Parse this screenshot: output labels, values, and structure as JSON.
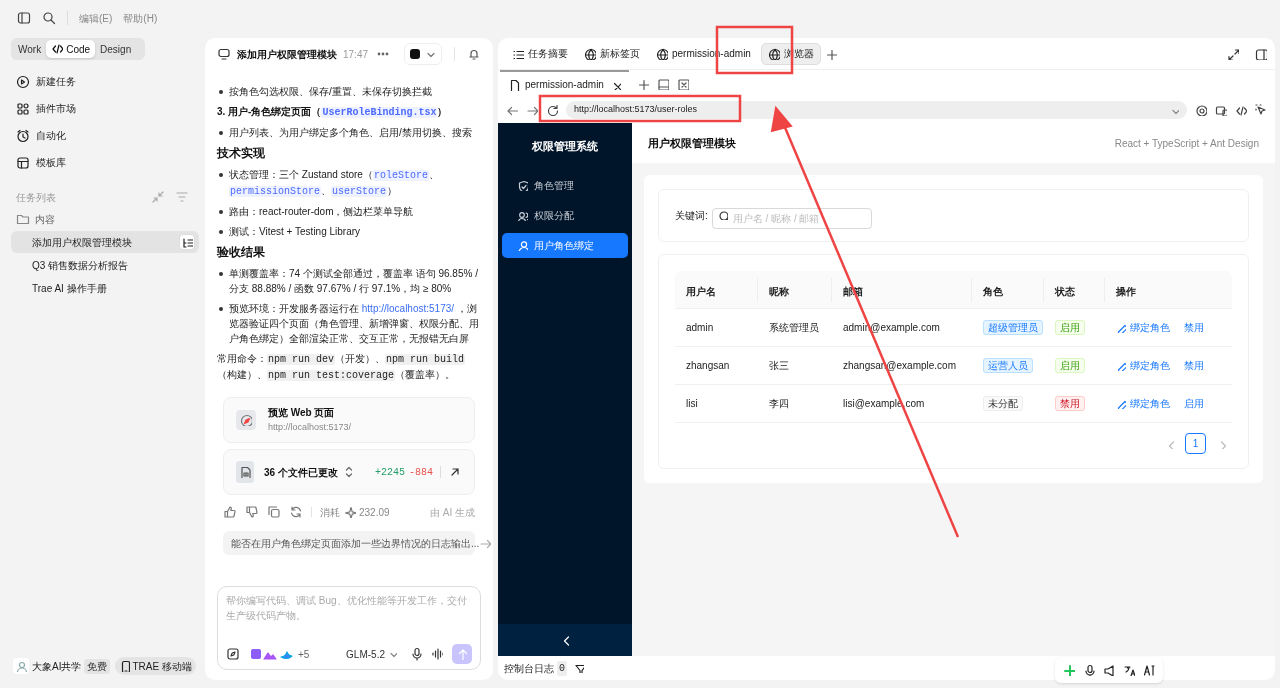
{
  "menu": [
    "编辑(E)",
    "帮助(H)"
  ],
  "modes": [
    {
      "label": "Work",
      "selected": false
    },
    {
      "label": "Code",
      "selected": true
    },
    {
      "label": "Design",
      "selected": false
    }
  ],
  "nav": [
    {
      "label": "新建任务",
      "kind": "new"
    },
    {
      "label": "插件市场",
      "kind": "plugins"
    },
    {
      "label": "自动化",
      "kind": "clock"
    },
    {
      "label": "模板库",
      "kind": "template"
    }
  ],
  "task_list": {
    "title": "任务列表",
    "folder": "内容",
    "tasks": [
      {
        "label": "添加用户权限管理模块",
        "selected": true
      },
      {
        "label": "Q3 销售数据分析报告",
        "selected": false
      },
      {
        "label": "Trae AI 操作手册",
        "selected": false
      }
    ]
  },
  "user": {
    "name": "大象AI共学",
    "badge": "免费"
  },
  "mobile_button": "TRAE 移动端",
  "chat": {
    "title": "添加用户权限管理模块",
    "time": "17:47",
    "blocks": [
      {
        "kind": "bullet",
        "parts": [
          {
            "kind": "text",
            "text": "按角色勾选权限、保存/重置、未保存切换拦截"
          }
        ]
      },
      {
        "kind": "subhead",
        "parts": [
          {
            "kind": "text",
            "text": "3. 用户-角色绑定页面（"
          },
          {
            "kind": "code",
            "text": "UserRoleBinding.tsx"
          },
          {
            "kind": "text",
            "text": "）"
          }
        ]
      },
      {
        "kind": "bullet",
        "parts": [
          {
            "kind": "text",
            "text": "用户列表、为用户绑定多个角色、启用/禁用切换、搜索"
          }
        ]
      },
      {
        "kind": "heading",
        "parts": [
          {
            "kind": "text",
            "text": "技术实现"
          }
        ]
      },
      {
        "kind": "bullet",
        "parts": [
          {
            "kind": "text",
            "text": "状态管理：三个 Zustand store（"
          },
          {
            "kind": "code",
            "text": "roleStore"
          },
          {
            "kind": "text",
            "text": "、"
          },
          {
            "kind": "code",
            "text": "permissionStore"
          },
          {
            "kind": "text",
            "text": "、"
          },
          {
            "kind": "code",
            "text": "userStore"
          },
          {
            "kind": "text",
            "text": "）"
          }
        ]
      },
      {
        "kind": "bullet",
        "parts": [
          {
            "kind": "text",
            "text": "路由：react-router-dom，侧边栏菜单导航"
          }
        ]
      },
      {
        "kind": "bullet",
        "parts": [
          {
            "kind": "text",
            "text": "测试：Vitest + Testing Library"
          }
        ]
      },
      {
        "kind": "heading",
        "parts": [
          {
            "kind": "text",
            "text": "验收结果"
          }
        ]
      },
      {
        "kind": "bullet",
        "parts": [
          {
            "kind": "text",
            "text": "单测覆盖率：74 个测试全部通过，覆盖率 语句 96.85% / 分支 88.88% / 函数 97.67% / 行 97.1%，均 ≥ 80%"
          }
        ]
      },
      {
        "kind": "bullet",
        "parts": [
          {
            "kind": "text",
            "text": "预览环境：开发服务器运行在 "
          },
          {
            "kind": "link",
            "text": "http://localhost:5173/"
          },
          {
            "kind": "text",
            "text": " ，浏览器验证四个页面（角色管理、新增弹窗、权限分配、用户角色绑定）全部渲染正常、交互正常，无报错无白屏"
          }
        ]
      },
      {
        "kind": "para",
        "parts": [
          {
            "kind": "text",
            "text": "常用命令："
          },
          {
            "kind": "cmd",
            "text": "npm run dev"
          },
          {
            "kind": "text",
            "text": "（开发）、"
          },
          {
            "kind": "cmd",
            "text": "npm run build"
          },
          {
            "kind": "text",
            "text": "（构建）、"
          },
          {
            "kind": "cmd",
            "text": "npm run test:coverage"
          },
          {
            "kind": "text",
            "text": "（覆盖率）。"
          }
        ]
      }
    ],
    "preview": {
      "title": "预览 Web 页面",
      "url": "http://localhost:5173/"
    },
    "files": {
      "label": "36 个文件已更改",
      "added": "+2245",
      "removed": "-884"
    },
    "cost_label": "消耗",
    "cost": "232.09",
    "ai_note": "由 AI 生成",
    "suggestion": "能否在用户角色绑定页面添加一些边界情况的日志输出...",
    "input_placeholder": "帮你编写代码、调试 Bug、优化性能等开发工作，交付生产级代码产物。",
    "extra_tools": "+5",
    "model": "GLM-5.2"
  },
  "browser": {
    "tabs": [
      {
        "label": "任务摘要",
        "kind": "list",
        "selected": false
      },
      {
        "label": "新标签页",
        "kind": "globe",
        "selected": false
      },
      {
        "label": "permission-admin",
        "kind": "globe",
        "selected": false
      },
      {
        "label": "浏览器",
        "kind": "globe",
        "selected": true
      }
    ],
    "page_tab": "permission-admin",
    "url": "http://localhost:5173/user-roles",
    "console": "控制台日志",
    "console_count": "0"
  },
  "app": {
    "title": "权限管理系统",
    "menu": [
      {
        "label": "角色管理",
        "kind": "shield",
        "selected": false
      },
      {
        "label": "权限分配",
        "kind": "users",
        "selected": false
      },
      {
        "label": "用户角色绑定",
        "kind": "user",
        "selected": true
      }
    ],
    "header": "用户权限管理模块",
    "stack": "React + TypeScript + Ant Design",
    "search_label": "关键词:",
    "search_placeholder": "用户名 / 昵称 / 邮箱",
    "columns": [
      "用户名",
      "昵称",
      "邮箱",
      "角色",
      "状态",
      "操作"
    ],
    "rows": [
      {
        "username": "admin",
        "nickname": "系统管理员",
        "email": "admin@example.com",
        "role": "超级管理员",
        "role_assigned": true,
        "status": "启用",
        "enabled": true,
        "bind": "绑定角色",
        "toggle": "禁用"
      },
      {
        "username": "zhangsan",
        "nickname": "张三",
        "email": "zhangsan@example.com",
        "role": "运营人员",
        "role_assigned": true,
        "status": "启用",
        "enabled": true,
        "bind": "绑定角色",
        "toggle": "禁用"
      },
      {
        "username": "lisi",
        "nickname": "李四",
        "email": "lisi@example.com",
        "role": "未分配",
        "role_assigned": false,
        "status": "禁用",
        "enabled": false,
        "bind": "绑定角色",
        "toggle": "启用"
      }
    ],
    "page": "1"
  }
}
